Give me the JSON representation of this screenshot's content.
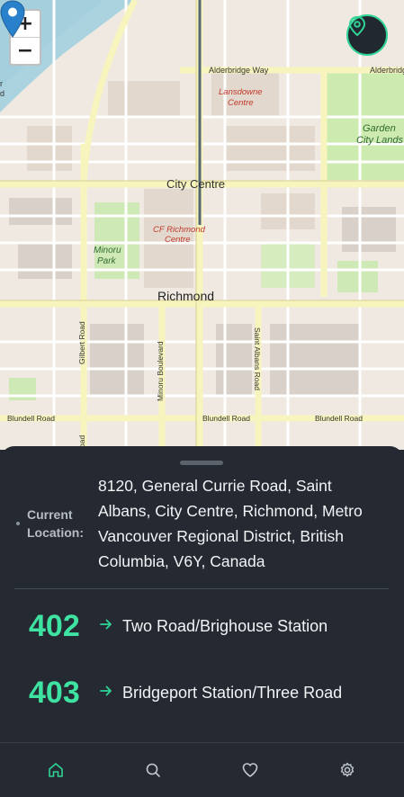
{
  "map": {
    "zoom_in_label": "+",
    "zoom_out_label": "−",
    "labels": {
      "alderbridge_way": "Alderbridge Way",
      "alderbridge_right": "Alderbridg",
      "lansdowne_centre_line1": "Lansdowne",
      "lansdowne_centre_line2": "Centre",
      "garden_city_line1": "Garden",
      "garden_city_line2": "City Lands",
      "city_centre": "City Centre",
      "cf_richmond_line1": "CF Richmond",
      "cf_richmond_line2": "Centre",
      "minoru_park_line1": "Minoru",
      "minoru_park_line2": "Park",
      "richmond": "Richmond",
      "gilbert_road": "Gilbert Road",
      "minoru_boulevard": "Minoru Boulevard",
      "saint_albans_road": "Saint Albans Road",
      "blundell_road_left": "Blundell Road",
      "blundell_road_mid": "Blundell Road",
      "blundell_road_right": "Blundell Road",
      "edge_r": "r",
      "edge_d": "d",
      "edge_oad": "oad"
    },
    "colors": {
      "accent": "#30d496",
      "pin": "#2a81cb",
      "water": "#aad3df",
      "park": "#c8e6b0",
      "road_major": "#f7f5bd"
    }
  },
  "location": {
    "label": "Current Location:",
    "value": "8120, General Currie Road, Saint Albans, City Centre, Richmond, Metro Vancouver Regional District, British Columbia, V6Y, Canada"
  },
  "routes": [
    {
      "number": "402",
      "destination": "Two Road/Brighouse Station"
    },
    {
      "number": "403",
      "destination": "Bridgeport Station/Three Road"
    }
  ],
  "nav": {
    "items": [
      {
        "name": "home-icon",
        "active": true
      },
      {
        "name": "search-icon",
        "active": false
      },
      {
        "name": "heart-icon",
        "active": false
      },
      {
        "name": "gear-icon",
        "active": false
      }
    ],
    "active_color": "#30d496",
    "inactive_color": "#c3c8cf"
  }
}
